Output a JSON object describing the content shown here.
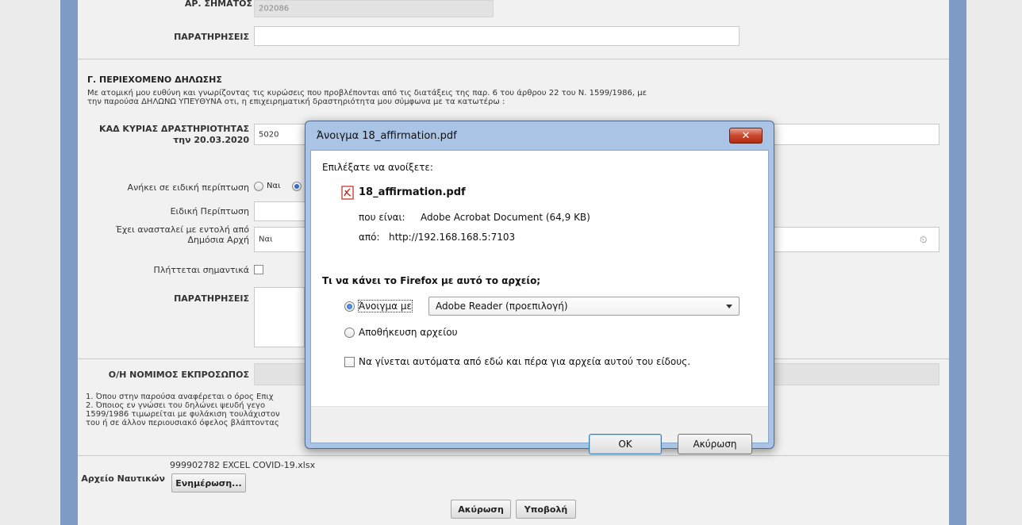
{
  "form": {
    "damage_no_label": "ΑΡ. ΣΗΜΑΤΟΣ",
    "damage_no_value": "202086",
    "notes_label": "ΠΑΡΑΤΗΡΗΣΕΙΣ",
    "section_g_title": "Γ. ΠΕΡΙΕΧΟΜΕΝΟ ΔΗΛΩΣΗΣ",
    "section_g_line1": "Με ατομική μου ευθύνη και γνωρίζοντας τις κυρώσεις που προβλέπονται από τις διατάξεις της παρ. 6 του άρθρου 22 του Ν. 1599/1986, με",
    "section_g_line2": "την παρούσα ΔΗΛΩΝΩ ΥΠΕΥΘΥΝΑ οτι, η επιχειρηματική δραστηριότητα μου σύμφωνα με τα κατωτέρω :",
    "kad_label_1": "ΚΑΔ ΚΥΡΙΑΣ ΔΡΑΣΤΗΡΙΟΤΗΤΑΣ",
    "kad_label_2": "την 20.03.2020",
    "kad_value": "5020",
    "special_case_label": "Ανήκει σε ειδική περίπτωση",
    "radio_yes": "Ναι",
    "special_case_field_label": "Ειδική Περίπτωση",
    "suspended_label_1": "Έχει ανασταλεί με εντολή από",
    "suspended_label_2": "Δημόσια Αρχή",
    "suspended_value": "Ναι",
    "hit_label": "Πλήττεται σημαντικά",
    "notes2_label": "ΠΑΡΑΤΗΡΗΣΕΙΣ",
    "legal_rep_label": "Ο/Η ΝΟΜΙΜΟΣ ΕΚΠΡΟΣΩΠΟΣ",
    "footnote_1": "1. Όπου στην παρούσα αναφέρεται ο όρος Επιχ",
    "footnote_2": "2. Όποιος εν γνώσει του δηλώνει ψευδή γεγο",
    "footnote_3": "1599/1986 τιμωρείται με φυλάκιση τουλάχιστον",
    "footnote_4": "του ή σε άλλον περιουσιακό όφελος βλάπτοντας",
    "file_label": "Αρχείο Ναυτικών",
    "file_name": "999902782 EXCEL COVID-19.xlsx",
    "update_button": "Ενημέρωση...",
    "cancel_button": "Ακύρωση",
    "submit_button": "Υποβολή"
  },
  "dialog": {
    "title": "Άνοιγμα 18_affirmation.pdf",
    "close_glyph": "✕",
    "choose_text": "Επιλέξατε να ανοίξετε:",
    "file_name": "18_affirmation.pdf",
    "type_label": "που είναι:",
    "type_value": "Adobe Acrobat Document (64,9 KB)",
    "from_label": "από:",
    "from_value": "http://192.168.168.5:7103",
    "question": "Τι να κάνει το Firefox με αυτό το αρχείο;",
    "open_with_label": "Άνοιγμα με",
    "open_with_value": "Adobe Reader  (προεπιλογή)",
    "save_label": "Αποθήκευση αρχείου",
    "auto_label": "Να γίνεται αυτόματα από εδώ και πέρα για αρχεία αυτού του είδους.",
    "ok_button": "OK",
    "cancel_button": "Ακύρωση"
  }
}
